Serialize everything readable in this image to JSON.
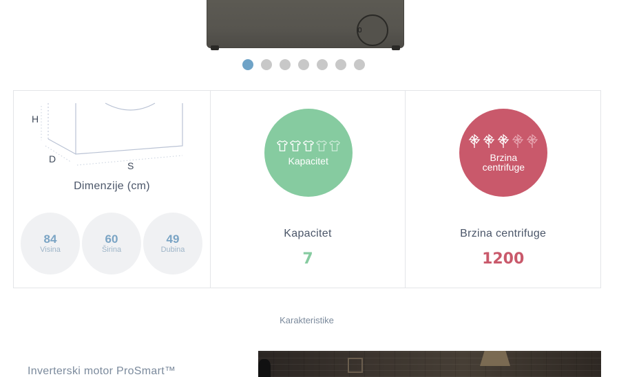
{
  "carousel": {
    "slide_count": 7,
    "active_index": 0
  },
  "dimensions": {
    "labels": {
      "h": "H",
      "d": "D",
      "s": "S"
    },
    "title": "Dimenzije (cm)",
    "items": [
      {
        "value": "84",
        "label": "Visina"
      },
      {
        "value": "60",
        "label": "Širina"
      },
      {
        "value": "49",
        "label": "Dubina"
      }
    ]
  },
  "capacity": {
    "circle_text": "Kapacitet",
    "label": "Kapacitet",
    "value": "7",
    "icon": "tshirt-icon",
    "icon_total": 5,
    "icon_filled": 3,
    "color": "#86cba0"
  },
  "spin": {
    "circle_text_line1": "Brzina",
    "circle_text_line2": "centrifuge",
    "label": "Brzina centrifuge",
    "value": "1200",
    "icon": "pinwheel-icon",
    "icon_total": 5,
    "icon_filled": 3,
    "color": "#c9596b"
  },
  "colors": {
    "accent_blue": "#6fa3c7",
    "dot_inactive": "#c8c8c8"
  },
  "features": {
    "heading": "Karakteristike",
    "first_title": "Inverterski motor ProSmart™"
  }
}
